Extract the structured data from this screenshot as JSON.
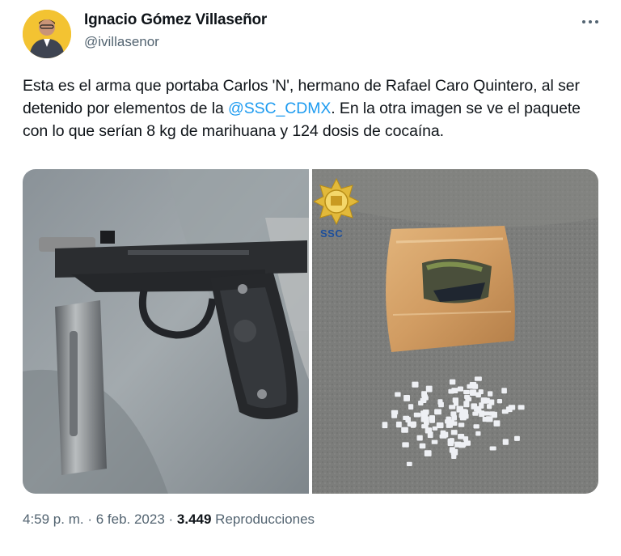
{
  "author": {
    "name": "Ignacio Gómez Villaseñor",
    "handle": "@ivillasenor"
  },
  "tweet": {
    "text_before": "Esta es el arma que portaba Carlos 'N', hermano de Rafael Caro Quintero, al ser detenido por elementos de la ",
    "mention": "@SSC_CDMX",
    "text_after": ". En la otra imagen se ve el paquete con lo que serían 8 kg de marihuana y 124 dosis de cocaína."
  },
  "media": {
    "badge_label": "SSC"
  },
  "meta": {
    "time": "4:59 p. m.",
    "sep1": " · ",
    "date": "6 feb. 2023",
    "sep2": " · ",
    "views_count": "3.449",
    "views_label": " Reproducciones"
  },
  "icons": {
    "more": "more-horizontal-icon",
    "badge": "ssc-shield-logo"
  },
  "colors": {
    "link": "#1d9bf0",
    "muted": "#536471",
    "text": "#0f1419"
  }
}
